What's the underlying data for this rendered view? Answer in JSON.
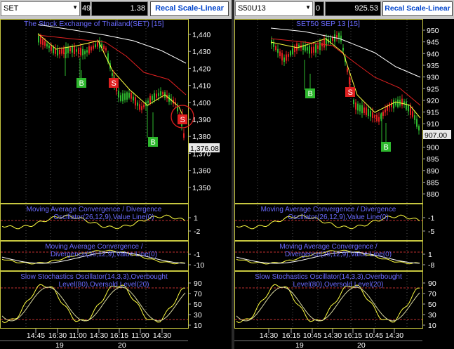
{
  "left": {
    "symbol": "SET",
    "period_value": "49",
    "change_value": "1.38",
    "scale_button": "Recal Scale-Linear",
    "chart_title": "The Stock Exchange of Thailand(SET) [15]",
    "price_ticks": [
      "1,440",
      "1,430",
      "1,420",
      "1,410",
      "1,400",
      "1,390",
      "1,380",
      "1,370",
      "1,360",
      "1,350"
    ],
    "last_price": "1,376.08",
    "signals": [
      {
        "type": "B",
        "text": "B",
        "color": "#2eb82e"
      },
      {
        "type": "S",
        "text": "S",
        "color": "#e02020"
      },
      {
        "type": "B",
        "text": "B",
        "color": "#2eb82e"
      },
      {
        "type": "S",
        "text": "S",
        "color": "#e02020"
      }
    ],
    "macd1_title_1": "Moving Average Convergence / Divergence",
    "macd1_title_2": "Oscillator(26,12,9),Value Line(0)",
    "macd1_ticks": [
      "1",
      "-2"
    ],
    "macd2_title_1": "Moving Average Convergence /",
    "macd2_title_2": "Divergence(26,12,9),Value Line(0)",
    "macd2_ticks": [
      "-1",
      "-10"
    ],
    "stoch_title_1": "Slow Stochastics Oscillator(14,3,3),Overbought",
    "stoch_title_2": "Level(80),Oversold Level(20)",
    "stoch_ticks": [
      "90",
      "70",
      "50",
      "30",
      "10"
    ],
    "time_labels": [
      "14:45",
      "16:30",
      "11:00",
      "14:30",
      "16:15",
      "11:00",
      "14:30"
    ],
    "date_labels": [
      "19",
      "20"
    ]
  },
  "right": {
    "symbol": "S50U13",
    "period_value": "0",
    "change_value": "925.53",
    "scale_button": "Recal Scale-Linear",
    "chart_title": "SET50 SEP 13   [15]",
    "price_ticks": [
      "950",
      "945",
      "940",
      "935",
      "930",
      "925",
      "920",
      "915",
      "910",
      "905",
      "900",
      "895",
      "890",
      "885",
      "880"
    ],
    "last_price": "907.00",
    "signals": [
      {
        "type": "B",
        "text": "B",
        "color": "#2eb82e"
      },
      {
        "type": "S",
        "text": "S",
        "color": "#e02020"
      },
      {
        "type": "B",
        "text": "B",
        "color": "#2eb82e"
      }
    ],
    "macd1_title_1": "Moving Average Convergence / Divergence",
    "macd1_title_2": "Oscillator(26,12,9),Value Line(0)",
    "macd1_ticks": [
      "-1",
      "-5"
    ],
    "macd2_title_1": "Moving Average Convergence /",
    "macd2_title_2": "Divergence(26,12,9),Value Line(0)",
    "macd2_ticks": [
      "1",
      "-8"
    ],
    "stoch_title_1": "Slow Stochastics Oscillator(14,3,3),Overbought",
    "stoch_title_2": "Level(80),Oversold Level(20)",
    "stoch_ticks": [
      "90",
      "70",
      "50",
      "30",
      "10"
    ],
    "time_labels": [
      "14:30",
      "16:15",
      "10:45",
      "14:30",
      "16:15",
      "10:45",
      "14:30"
    ],
    "date_labels": [
      "19",
      "20"
    ]
  },
  "colors": {
    "title": "#6a6aff",
    "up_candle": "#2eb82e",
    "down_candle": "#e02020",
    "ma_yellow": "#ffff40",
    "ma_red": "#e02020",
    "ma_white": "#ffffff",
    "grid": "#555555",
    "panel_border": "#c8c840",
    "reference": "#c03030"
  }
}
